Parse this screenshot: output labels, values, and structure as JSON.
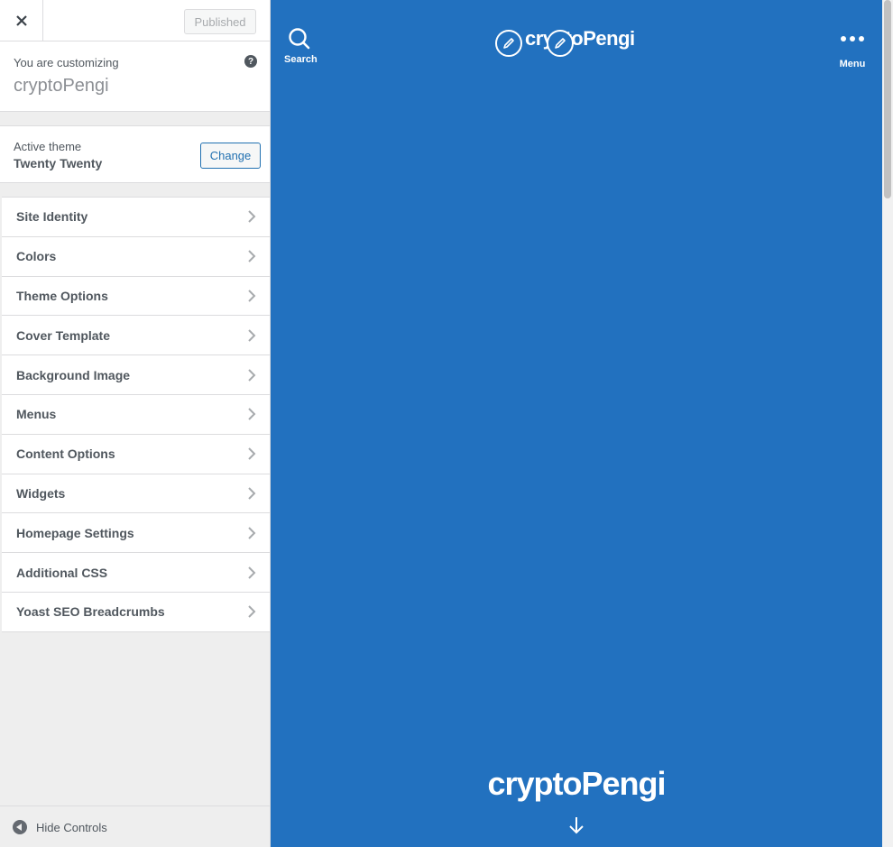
{
  "topbar": {
    "close_icon": "close-icon",
    "published_label": "Published"
  },
  "customizing": {
    "label": "You are customizing",
    "site_name": "cryptoPengi",
    "help_icon": "?"
  },
  "theme": {
    "label": "Active theme",
    "name": "Twenty Twenty",
    "change_label": "Change"
  },
  "sections": [
    {
      "label": "Site Identity"
    },
    {
      "label": "Colors"
    },
    {
      "label": "Theme Options"
    },
    {
      "label": "Cover Template"
    },
    {
      "label": "Background Image"
    },
    {
      "label": "Menus"
    },
    {
      "label": "Content Options"
    },
    {
      "label": "Widgets"
    },
    {
      "label": "Homepage Settings"
    },
    {
      "label": "Additional CSS"
    },
    {
      "label": "Yoast SEO Breadcrumbs"
    }
  ],
  "footer": {
    "hide_controls_label": "Hide Controls"
  },
  "preview": {
    "search_label": "Search",
    "menu_label": "Menu",
    "site_title": "cryptoPengi",
    "cover_title": "cryptoPengi",
    "background_color": "#2271bf"
  }
}
